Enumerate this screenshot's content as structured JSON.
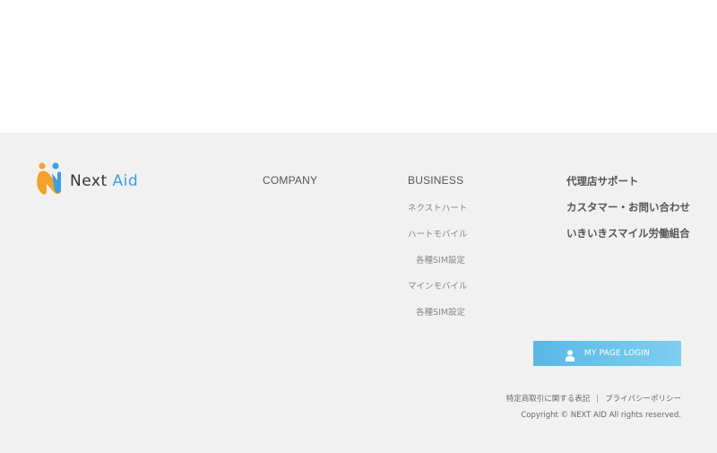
{
  "logo": {
    "brand_main": "Next ",
    "brand_accent": "Aid"
  },
  "footer": {
    "company_heading": "COMPANY",
    "business_heading": "BUSINESS",
    "business_items": [
      "ネクストハート",
      "ハートモバイル",
      "各種SIM設定",
      "マインモバイル",
      "各種SIM設定"
    ],
    "right_links": [
      "代理店サポート",
      "カスタマー・お問い合わせ",
      "いきいきスマイル労働組合"
    ],
    "login_label": "MY PAGE LOGIN",
    "legal_link_1": "特定商取引に関する表記",
    "legal_separator": "|",
    "legal_link_2": "プライバシーポリシー",
    "copyright": "Copyright © NEXT AID All rights reserved."
  },
  "colors": {
    "footer_bg": "#f1f1f1",
    "login_gradient_start": "#5ab7e6",
    "login_gradient_end": "#7ecff0",
    "logo_orange": "#f3a22b",
    "logo_blue": "#3aa0e0"
  }
}
